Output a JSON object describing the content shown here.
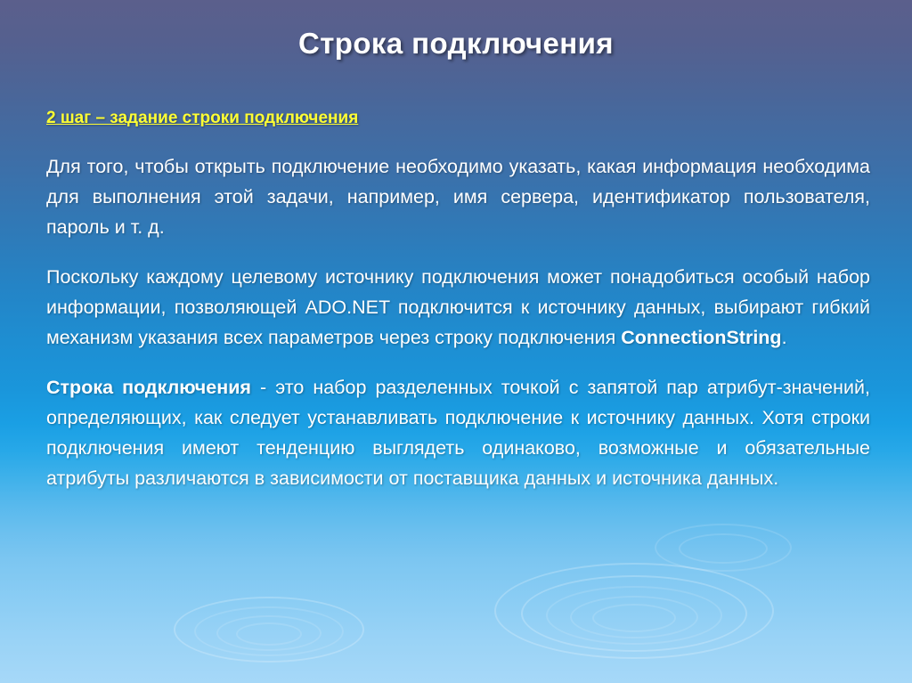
{
  "slide": {
    "title": "Строка подключения",
    "subhead": "2 шаг – задание строки подключения",
    "paragraphs": {
      "p1": "Для того, чтобы открыть подключение необходимо указать, какая информация необходима для выполнения этой задачи, например, имя сервера, идентификатор пользователя, пароль и т. д.",
      "p2_a": "Поскольку каждому целевому источнику подключения может понадобиться особый набор информации, позволяющей ADO.NET подключится к источнику данных, выбирают гибкий механизм указания всех параметров через строку подключения ",
      "p2_bold": "ConnectionString",
      "p2_b": ".",
      "p3_bold": " Строка подключения",
      "p3_a": " - это набор разделенных точкой с запятой пар атрибут-значений, определяющих, как следует устанавливать подключение к источнику данных. Хотя строки подключения имеют тенденцию выглядеть одинаково, возможные и обязательные атрибуты различаются в зависимости от поставщика данных и источника данных."
    }
  },
  "colors": {
    "title_text": "#ffffff",
    "subhead_text": "#ffff33",
    "body_text": "#ffffff",
    "bg_top": "#5b5f8c",
    "bg_bottom": "#a6d8f8"
  }
}
